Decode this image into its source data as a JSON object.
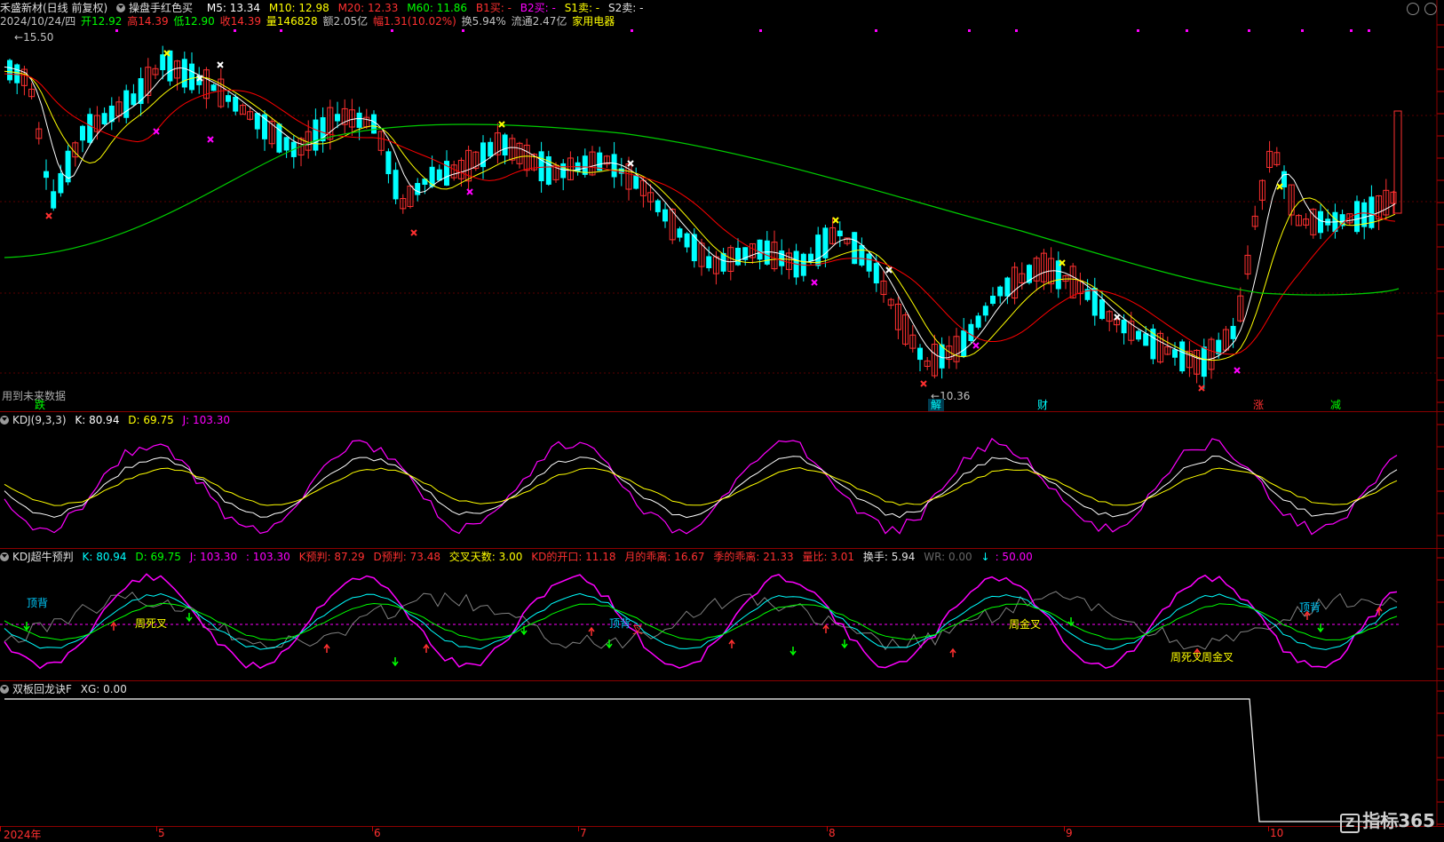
{
  "main_header": {
    "title": "禾盛新材(日线 前复权)",
    "indicator_name": "操盘手红色买",
    "m5": "M5: 13.34",
    "m10": "M10: 12.98",
    "m20": "M20: 12.33",
    "m60": "M60: 11.86",
    "b1": "B1买: -",
    "b2": "B2买: -",
    "s1": "S1卖: -",
    "s2": "S2卖: -"
  },
  "info_line": {
    "date": "2024/10/24/四",
    "open": "开12.92",
    "high": "高14.39",
    "low": "低12.90",
    "close": "收14.39",
    "volume": "量146828",
    "amount": "额2.05亿",
    "change": "幅1.31(10.02%)",
    "turnover": "换5.94%",
    "float": "流通2.47亿",
    "sector": "家用电器"
  },
  "main_chart": {
    "high_label": "15.50",
    "low_label": "10.36",
    "future_text": "用到未来数据",
    "markers": [
      {
        "text": "跌",
        "color": "#00ff00"
      },
      {
        "text": "解",
        "color": "#00ffff"
      },
      {
        "text": "财",
        "color": "#00ffff"
      },
      {
        "text": "涨",
        "color": "#ff3030"
      },
      {
        "text": "减",
        "color": "#00ff00"
      }
    ]
  },
  "kdj_header": {
    "name": "KDJ(9,3,3)",
    "k": "K: 80.94",
    "d": "D: 69.75",
    "j": "J: 103.30"
  },
  "kdj2_header": {
    "name": "KDJ超牛预判",
    "k": "K: 80.94",
    "d": "D: 69.75",
    "j": "J: 103.30",
    "j2": ": 103.30",
    "kpred": "K预判: 87.29",
    "dpred": "D预判: 73.48",
    "cross_days": "交叉天数: 3.00",
    "kd_open": "KD的开口: 11.18",
    "month_dev": "月的乖离: 16.67",
    "season_dev": "季的乖离: 21.33",
    "vol_ratio": "量比: 3.01",
    "turnover": "换手: 5.94",
    "wr": "WR: 0.00",
    "last": ": 50.00"
  },
  "kdj2_annotations": {
    "top_div_1": "顶背",
    "week_dead": "周死叉",
    "top_div_2": "顶背",
    "week_gold_1": "周金叉",
    "week_dead_2": "周死叉",
    "week_gold_2": "周金叉",
    "top_div_3": "顶背",
    "mid_label": "叉"
  },
  "sb_header": {
    "name": "双板回龙诀F",
    "xg": "XG: 0.00"
  },
  "time_axis": [
    "2024年",
    "5",
    "6",
    "7",
    "8",
    "9",
    "10"
  ],
  "logo": {
    "text": "指标365",
    "mark": "Z"
  },
  "colors": {
    "up": "#ff3030",
    "down": "#00ffff",
    "ma5": "#ffffff",
    "ma10": "#ffff00",
    "ma20": "#ff0000",
    "ma60": "#00cc00",
    "k": "#ffffff",
    "d": "#ffff00",
    "j": "#ff00ff"
  }
}
